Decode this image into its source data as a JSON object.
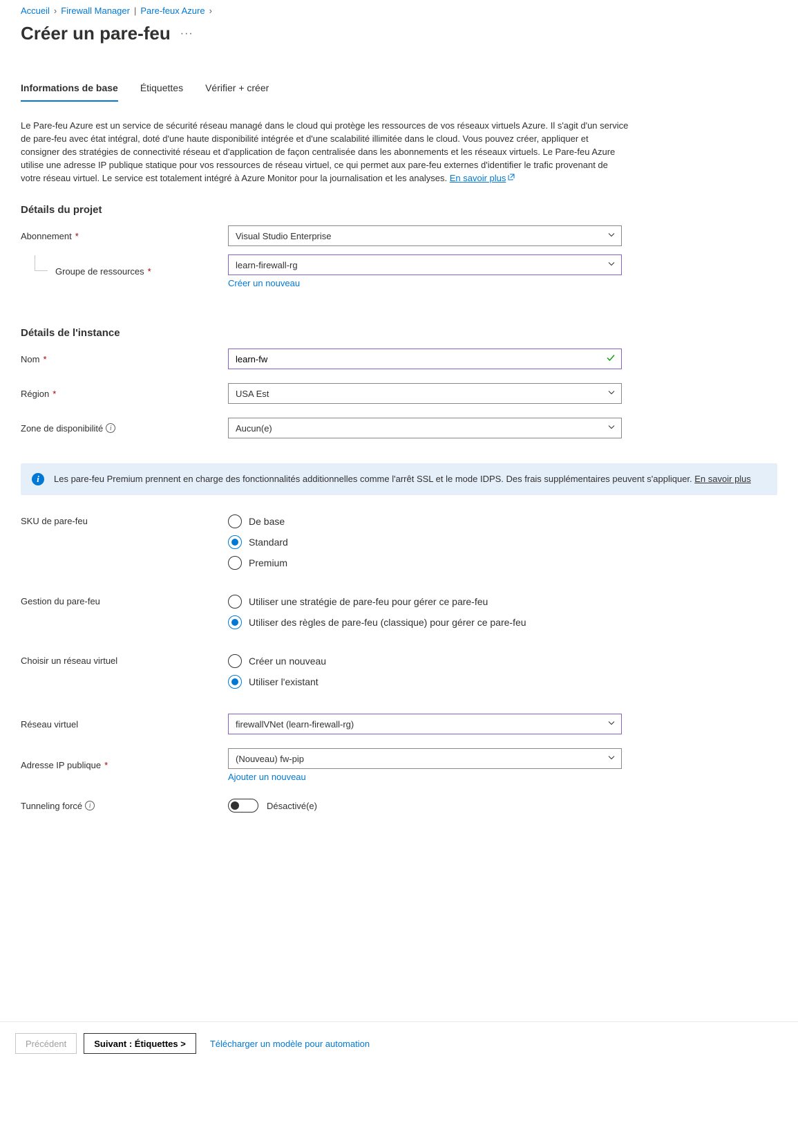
{
  "breadcrumb": {
    "home": "Accueil",
    "fm": "Firewall Manager",
    "fw": "Pare-feux Azure"
  },
  "title": "Créer un pare-feu",
  "tabs": {
    "basics": "Informations de base",
    "tags": "Étiquettes",
    "review": "Vérifier + créer"
  },
  "intro": {
    "text": "Le Pare-feu Azure est un service de sécurité réseau managé dans le cloud qui protège les ressources de vos réseaux virtuels Azure. Il s'agit d'un service de pare-feu avec état intégral, doté d'une haute disponibilité intégrée et d'une scalabilité illimitée dans le cloud. Vous pouvez créer, appliquer et consigner des stratégies de connectivité réseau et d'application de façon centralisée dans les abonnements et les réseaux virtuels. Le Pare-feu Azure utilise une adresse IP publique statique pour vos ressources de réseau virtuel, ce qui permet aux pare-feu externes d'identifier le trafic provenant de votre réseau virtuel. Le service est totalement intégré à Azure Monitor pour la journalisation et les analyses. ",
    "learn_more": "En savoir plus"
  },
  "project": {
    "heading": "Détails du projet",
    "subscription_label": "Abonnement",
    "subscription_value": "Visual Studio Enterprise",
    "rg_label": "Groupe de ressources",
    "rg_value": "learn-firewall-rg",
    "rg_create": "Créer un nouveau"
  },
  "instance": {
    "heading": "Détails de l'instance",
    "name_label": "Nom",
    "name_value": "learn-fw",
    "region_label": "Région",
    "region_value": "USA Est",
    "az_label": "Zone de disponibilité",
    "az_value": "Aucun(e)"
  },
  "premium_info": {
    "text": "Les pare-feu Premium prennent en charge des fonctionnalités additionnelles comme l'arrêt SSL et le mode IDPS. Des frais supplémentaires peuvent s'appliquer. ",
    "link": "En savoir plus"
  },
  "sku": {
    "label": "SKU de pare-feu",
    "basic": "De base",
    "standard": "Standard",
    "premium": "Premium"
  },
  "mgmt": {
    "label": "Gestion du pare-feu",
    "policy": "Utiliser une stratégie de pare-feu pour gérer ce pare-feu",
    "classic": "Utiliser des règles de pare-feu (classique) pour gérer ce pare-feu"
  },
  "vnet": {
    "label": "Choisir un réseau virtuel",
    "create": "Créer un nouveau",
    "existing": "Utiliser l'existant"
  },
  "vnet_select": {
    "label": "Réseau virtuel",
    "value": "firewallVNet (learn-firewall-rg)"
  },
  "pip": {
    "label": "Adresse IP publique",
    "value": "(Nouveau) fw-pip",
    "add_new": "Ajouter un nouveau"
  },
  "tunnel": {
    "label": "Tunneling forcé",
    "state": "Désactivé(e)"
  },
  "footer": {
    "prev": "Précédent",
    "next": "Suivant : Étiquettes >",
    "download": "Télécharger un modèle pour automation"
  }
}
